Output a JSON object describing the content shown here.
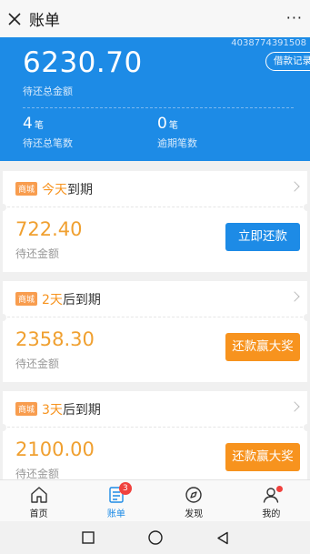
{
  "topbar": {
    "title": "账单",
    "more": "···"
  },
  "hero": {
    "uid": "4038774391508",
    "total_amount": "6230.70",
    "total_label": "待还总金额",
    "history_button": "借款记录",
    "stats": [
      {
        "num": "4",
        "unit": "笔",
        "label": "待还总笔数"
      },
      {
        "num": "0",
        "unit": "笔",
        "label": "逾期笔数"
      }
    ]
  },
  "bills": [
    {
      "tag": "商城",
      "days": "今天",
      "suffix": "到期",
      "amount": "722.40",
      "amount_label": "待还金额",
      "button": "立即还款",
      "button_color": "#1d8be6"
    },
    {
      "tag": "商城",
      "days": "2天",
      "suffix": "后到期",
      "amount": "2358.30",
      "amount_label": "待还金额",
      "button": "还款赢大奖",
      "button_color": "#f7931e"
    },
    {
      "tag": "商城",
      "days": "3天",
      "suffix": "后到期",
      "amount": "2100.00",
      "amount_label": "待还金额",
      "button": "还款赢大奖",
      "button_color": "#f7931e"
    }
  ],
  "tabs": [
    {
      "label": "首页",
      "icon": "home-icon"
    },
    {
      "label": "账单",
      "icon": "bill-icon",
      "badge": "3",
      "active": true
    },
    {
      "label": "发现",
      "icon": "compass-icon"
    },
    {
      "label": "我的",
      "icon": "user-icon"
    }
  ],
  "colors": {
    "primary": "#1d8be6",
    "accent": "#f7931e",
    "badge": "#f0413d"
  }
}
